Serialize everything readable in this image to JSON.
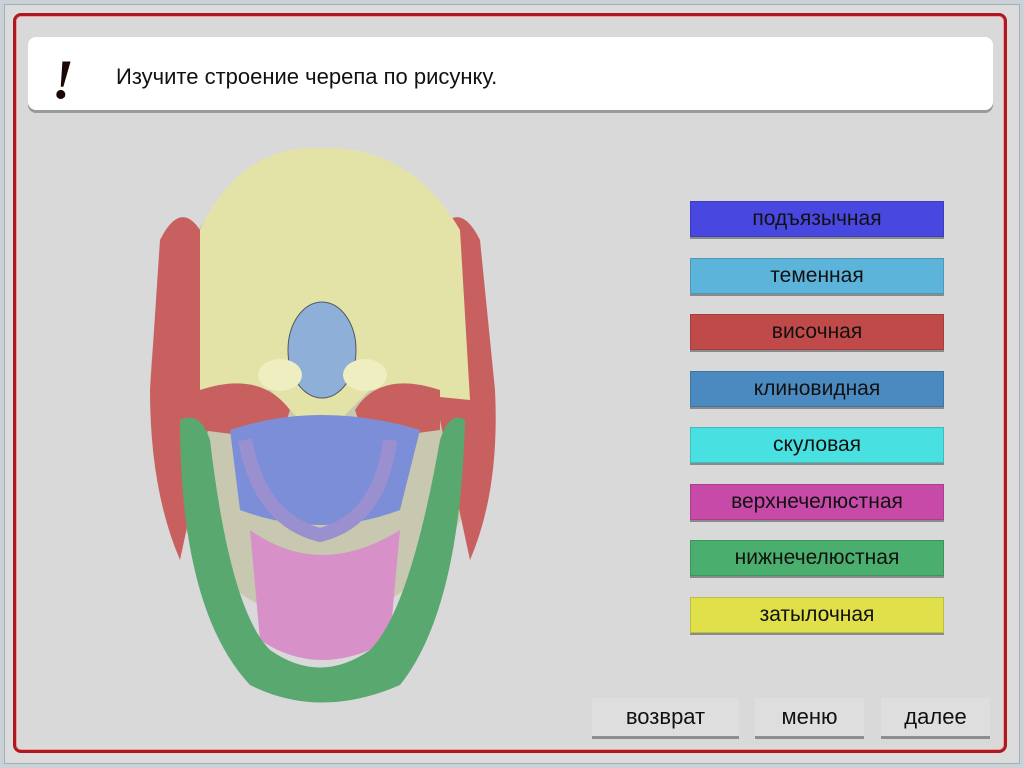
{
  "header": {
    "icon": "exclamation-icon",
    "text": "Изучите строение черепа по рисунку."
  },
  "bones": [
    {
      "label": "подъязычная",
      "color": "#4848e0"
    },
    {
      "label": "теменная",
      "color": "#5cb4da"
    },
    {
      "label": "височная",
      "color": "#c04a4a"
    },
    {
      "label": "клиновидная",
      "color": "#4a8ac0"
    },
    {
      "label": "скуловая",
      "color": "#48e0e0"
    },
    {
      "label": "верхнечелюстная",
      "color": "#c84aa8"
    },
    {
      "label": "нижнечелюстная",
      "color": "#4aae6e"
    },
    {
      "label": "затылочная",
      "color": "#e0e04a"
    }
  ],
  "nav": {
    "back": "возврат",
    "menu": "меню",
    "next": "далее"
  }
}
